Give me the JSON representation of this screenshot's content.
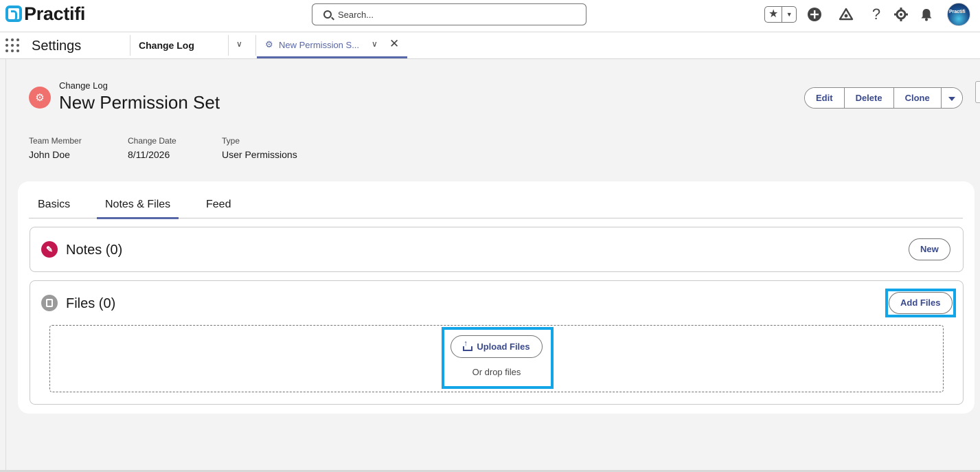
{
  "header": {
    "logo_text": "Practifi",
    "search_placeholder": "Search...",
    "avatar_text": "Practifi"
  },
  "nav": {
    "app_name": "Settings",
    "tabs": [
      {
        "label": "Change Log"
      },
      {
        "label": "New Permission S..."
      }
    ]
  },
  "record": {
    "object_type": "Change Log",
    "title": "New Permission Set",
    "actions": [
      "Edit",
      "Delete",
      "Clone"
    ],
    "fields": [
      {
        "label": "Team Member",
        "value": "John Doe"
      },
      {
        "label": "Change Date",
        "value": "8/11/2026"
      },
      {
        "label": "Type",
        "value": "User Permissions"
      }
    ]
  },
  "detail_tabs": [
    "Basics",
    "Notes & Files",
    "Feed"
  ],
  "active_tab": "Notes & Files",
  "notes": {
    "title": "Notes (0)",
    "new_button": "New"
  },
  "files": {
    "title": "Files (0)",
    "add_button": "Add Files",
    "upload_button": "Upload Files",
    "drop_text": "Or drop files"
  },
  "colors": {
    "accent": "#5867a8",
    "button_text": "#3a4a8c",
    "record_icon": "#f0706d",
    "notes_icon": "#c2184f",
    "highlight": "#12a6e8"
  }
}
